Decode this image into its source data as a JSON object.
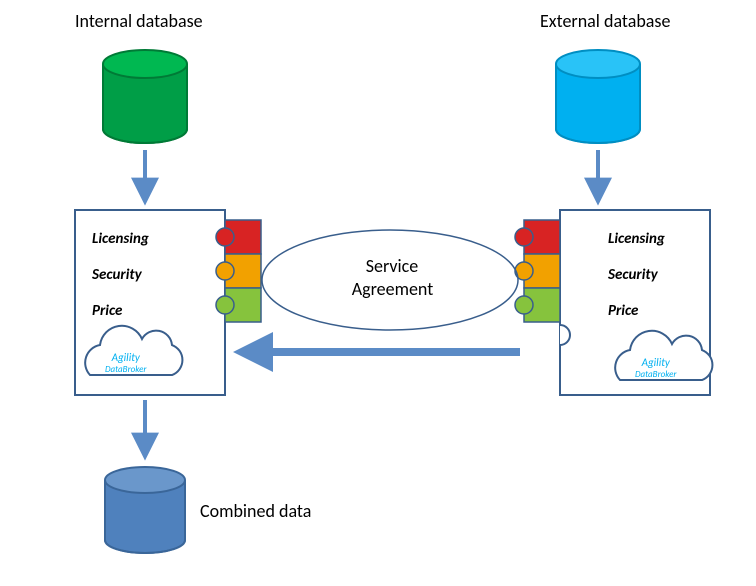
{
  "titles": {
    "internal": "Internal database",
    "external": "External database",
    "combined": "Combined data"
  },
  "center": {
    "line1": "Service",
    "line2": "Agreement"
  },
  "box": {
    "item1": "Licensing",
    "item2": "Security",
    "item3": "Price"
  },
  "cloud": {
    "line1": "Agility",
    "line2": "DataBroker"
  },
  "colors": {
    "green": "#009E47",
    "blue": "#00B0F0",
    "slate": "#4F81BD",
    "arrow": "#5B8BC6",
    "red": "#D82323",
    "orange": "#F2A100",
    "lime": "#86C33D",
    "boxStroke": "#395E8C"
  }
}
